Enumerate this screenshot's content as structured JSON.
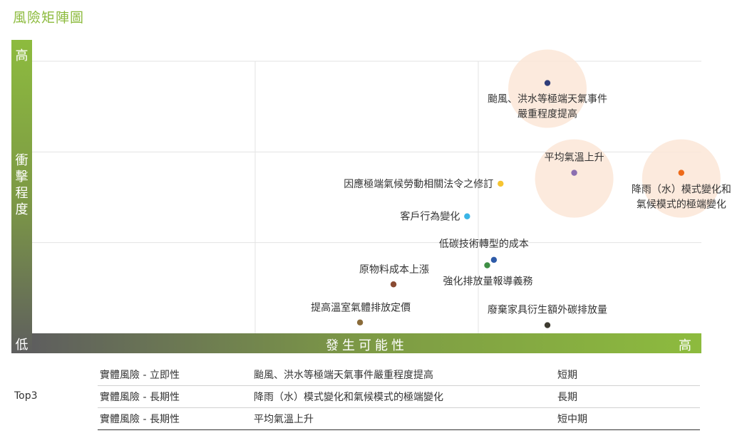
{
  "title": "風險矩陣圖",
  "y_axis": {
    "high": "高",
    "title": "衝擊程度",
    "low": "低"
  },
  "x_axis": {
    "title": "發生可能性",
    "high": "高"
  },
  "chart_data": {
    "type": "scatter",
    "xlabel": "發生可能性",
    "ylabel": "衝擊程度",
    "xlim": [
      0,
      1
    ],
    "ylim": [
      0,
      1
    ],
    "grid": true,
    "points": [
      {
        "label": "颱風、洪水等極端天氣事件\n嚴重程度提高",
        "x": 0.77,
        "y": 0.92,
        "color": "#2f3d7a",
        "highlight": true
      },
      {
        "label": "降雨（水）模式變化和\n氣候模式的極端變化",
        "x": 0.97,
        "y": 0.59,
        "color": "#ee6a19",
        "highlight": true
      },
      {
        "label": "平均氣溫上升",
        "x": 0.81,
        "y": 0.59,
        "color": "#8b6fb0",
        "highlight": true
      },
      {
        "label": "因應極端氣候勞動相關法令之修訂",
        "x": 0.7,
        "y": 0.55,
        "color": "#f6c431",
        "highlight": false
      },
      {
        "label": "客戶行為變化",
        "x": 0.65,
        "y": 0.43,
        "color": "#3ab5e6",
        "highlight": false
      },
      {
        "label": "低碳技術轉型的成本",
        "x": 0.69,
        "y": 0.27,
        "color": "#2e5ba8",
        "highlight": false
      },
      {
        "label": "強化排放量報導義務",
        "x": 0.68,
        "y": 0.25,
        "color": "#3f8f45",
        "highlight": false
      },
      {
        "label": "原物料成本上漲",
        "x": 0.54,
        "y": 0.18,
        "color": "#8a4b33",
        "highlight": false
      },
      {
        "label": "提高溫室氣體排放定價",
        "x": 0.49,
        "y": 0.04,
        "color": "#8a6b3a",
        "highlight": false
      },
      {
        "label": "廢棄家具衍生額外碳排放量",
        "x": 0.77,
        "y": 0.03,
        "color": "#3d3a30",
        "highlight": false
      }
    ]
  },
  "table": {
    "group_label": "Top3",
    "rows": [
      {
        "category": "實體風險 - 立即性",
        "risk": "颱風、洪水等極端天氣事件嚴重程度提高",
        "term": "短期"
      },
      {
        "category": "實體風險 - 長期性",
        "risk": "降雨（水）模式變化和氣候模式的極端變化",
        "term": "長期"
      },
      {
        "category": "實體風險 - 長期性",
        "risk": "平均氣溫上升",
        "term": "短中期"
      }
    ]
  }
}
